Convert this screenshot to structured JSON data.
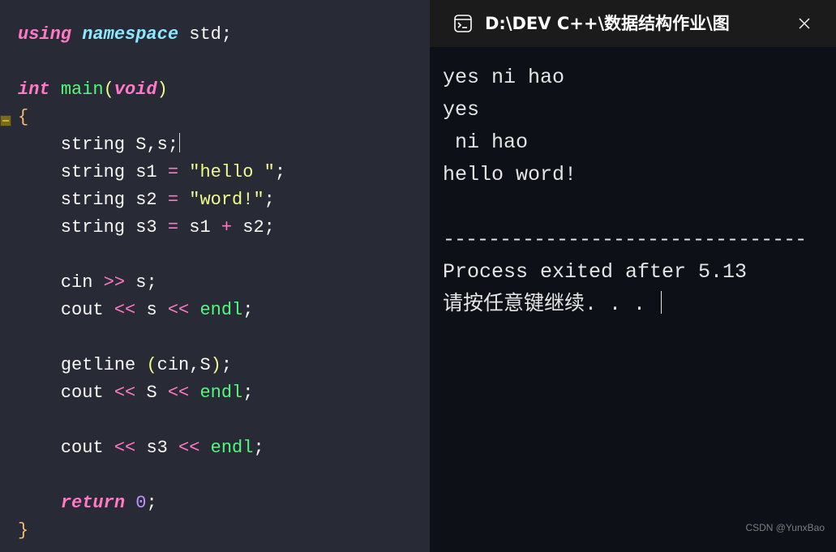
{
  "editor": {
    "lines": [
      [
        {
          "cls": "tok-kwit",
          "t": "using"
        },
        {
          "cls": "tok-punc",
          "t": " "
        },
        {
          "cls": "tok-ns",
          "t": "namespace"
        },
        {
          "cls": "tok-punc",
          "t": " "
        },
        {
          "cls": "tok-atom",
          "t": "std"
        },
        {
          "cls": "tok-punc",
          "t": ";"
        }
      ],
      [],
      [
        {
          "cls": "tok-kwit",
          "t": "int"
        },
        {
          "cls": "tok-punc",
          "t": " "
        },
        {
          "cls": "tok-func",
          "t": "main"
        },
        {
          "cls": "tok-paren",
          "t": "("
        },
        {
          "cls": "tok-kwit",
          "t": "void"
        },
        {
          "cls": "tok-paren",
          "t": ")"
        }
      ],
      [
        {
          "cls": "tok-brace",
          "t": "{"
        }
      ],
      [
        {
          "cls": "tok-punc",
          "t": "    string "
        },
        {
          "cls": "tok-ident",
          "t": "S"
        },
        {
          "cls": "tok-punc",
          "t": ","
        },
        {
          "cls": "tok-ident",
          "t": "s"
        },
        {
          "cls": "tok-punc",
          "t": ";"
        },
        {
          "cls": "cursor",
          "t": ""
        }
      ],
      [
        {
          "cls": "tok-punc",
          "t": "    string "
        },
        {
          "cls": "tok-ident",
          "t": "s1"
        },
        {
          "cls": "tok-punc",
          "t": " "
        },
        {
          "cls": "tok-op",
          "t": "="
        },
        {
          "cls": "tok-punc",
          "t": " "
        },
        {
          "cls": "tok-str",
          "t": "\"hello \""
        },
        {
          "cls": "tok-punc",
          "t": ";"
        }
      ],
      [
        {
          "cls": "tok-punc",
          "t": "    string "
        },
        {
          "cls": "tok-ident",
          "t": "s2"
        },
        {
          "cls": "tok-punc",
          "t": " "
        },
        {
          "cls": "tok-op",
          "t": "="
        },
        {
          "cls": "tok-punc",
          "t": " "
        },
        {
          "cls": "tok-str",
          "t": "\"word!\""
        },
        {
          "cls": "tok-punc",
          "t": ";"
        }
      ],
      [
        {
          "cls": "tok-punc",
          "t": "    string "
        },
        {
          "cls": "tok-ident",
          "t": "s3"
        },
        {
          "cls": "tok-punc",
          "t": " "
        },
        {
          "cls": "tok-op",
          "t": "="
        },
        {
          "cls": "tok-punc",
          "t": " "
        },
        {
          "cls": "tok-ident",
          "t": "s1"
        },
        {
          "cls": "tok-punc",
          "t": " "
        },
        {
          "cls": "tok-op",
          "t": "+"
        },
        {
          "cls": "tok-punc",
          "t": " "
        },
        {
          "cls": "tok-ident",
          "t": "s2"
        },
        {
          "cls": "tok-punc",
          "t": ";"
        }
      ],
      [],
      [
        {
          "cls": "tok-punc",
          "t": "    "
        },
        {
          "cls": "tok-iostr",
          "t": "cin"
        },
        {
          "cls": "tok-punc",
          "t": " "
        },
        {
          "cls": "tok-op",
          "t": ">>"
        },
        {
          "cls": "tok-punc",
          "t": " "
        },
        {
          "cls": "tok-ident",
          "t": "s"
        },
        {
          "cls": "tok-punc",
          "t": ";"
        }
      ],
      [
        {
          "cls": "tok-punc",
          "t": "    "
        },
        {
          "cls": "tok-iostr",
          "t": "cout"
        },
        {
          "cls": "tok-punc",
          "t": " "
        },
        {
          "cls": "tok-op",
          "t": "<<"
        },
        {
          "cls": "tok-punc",
          "t": " "
        },
        {
          "cls": "tok-ident",
          "t": "s"
        },
        {
          "cls": "tok-punc",
          "t": " "
        },
        {
          "cls": "tok-op",
          "t": "<<"
        },
        {
          "cls": "tok-punc",
          "t": " "
        },
        {
          "cls": "tok-func",
          "t": "endl"
        },
        {
          "cls": "tok-punc",
          "t": ";"
        }
      ],
      [],
      [
        {
          "cls": "tok-punc",
          "t": "    "
        },
        {
          "cls": "tok-atom",
          "t": "getline"
        },
        {
          "cls": "tok-punc",
          "t": " "
        },
        {
          "cls": "tok-paren",
          "t": "("
        },
        {
          "cls": "tok-iostr",
          "t": "cin"
        },
        {
          "cls": "tok-punc",
          "t": ","
        },
        {
          "cls": "tok-ident",
          "t": "S"
        },
        {
          "cls": "tok-paren",
          "t": ")"
        },
        {
          "cls": "tok-punc",
          "t": ";"
        }
      ],
      [
        {
          "cls": "tok-punc",
          "t": "    "
        },
        {
          "cls": "tok-iostr",
          "t": "cout"
        },
        {
          "cls": "tok-punc",
          "t": " "
        },
        {
          "cls": "tok-op",
          "t": "<<"
        },
        {
          "cls": "tok-punc",
          "t": " "
        },
        {
          "cls": "tok-ident",
          "t": "S"
        },
        {
          "cls": "tok-punc",
          "t": " "
        },
        {
          "cls": "tok-op",
          "t": "<<"
        },
        {
          "cls": "tok-punc",
          "t": " "
        },
        {
          "cls": "tok-func",
          "t": "endl"
        },
        {
          "cls": "tok-punc",
          "t": ";"
        }
      ],
      [],
      [
        {
          "cls": "tok-punc",
          "t": "    "
        },
        {
          "cls": "tok-iostr",
          "t": "cout"
        },
        {
          "cls": "tok-punc",
          "t": " "
        },
        {
          "cls": "tok-op",
          "t": "<<"
        },
        {
          "cls": "tok-punc",
          "t": " "
        },
        {
          "cls": "tok-ident",
          "t": "s3"
        },
        {
          "cls": "tok-punc",
          "t": " "
        },
        {
          "cls": "tok-op",
          "t": "<<"
        },
        {
          "cls": "tok-punc",
          "t": " "
        },
        {
          "cls": "tok-func",
          "t": "endl"
        },
        {
          "cls": "tok-punc",
          "t": ";"
        }
      ],
      [],
      [
        {
          "cls": "tok-punc",
          "t": "    "
        },
        {
          "cls": "tok-kwit",
          "t": "return"
        },
        {
          "cls": "tok-punc",
          "t": " "
        },
        {
          "cls": "tok-num",
          "t": "0"
        },
        {
          "cls": "tok-punc",
          "t": ";"
        }
      ],
      [
        {
          "cls": "tok-brace",
          "t": "}"
        }
      ]
    ]
  },
  "console": {
    "title": "D:\\DEV C++\\数据结构作业\\图",
    "output": [
      "yes ni hao",
      "yes",
      " ni hao",
      "hello word!",
      "",
      "--------------------------------",
      "Process exited after 5.13",
      "请按任意键继续. . . "
    ]
  },
  "watermark": "CSDN @YunxBao"
}
